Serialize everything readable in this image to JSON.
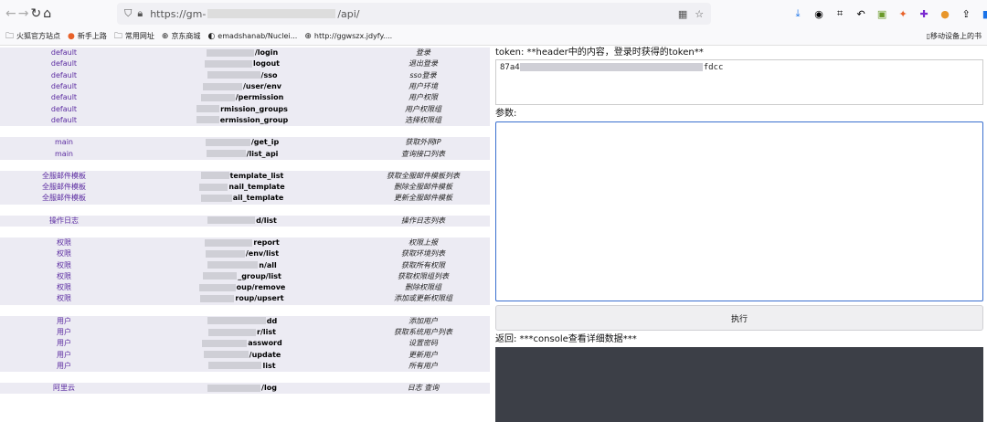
{
  "browser": {
    "url_prefix": "https://gm-",
    "url_suffix": "/api/",
    "bookmarks": [
      {
        "icon": "folder-icon",
        "label": "火狐官方站点"
      },
      {
        "icon": "firefox-icon",
        "label": "新手上路"
      },
      {
        "icon": "folder-icon",
        "label": "常用网址"
      },
      {
        "icon": "globe-icon",
        "label": "京东商城"
      },
      {
        "icon": "github-icon",
        "label": "emadshanab/Nuclei..."
      },
      {
        "icon": "globe-icon",
        "label": "http://ggwszx.jdyfy...."
      }
    ],
    "mobile_bookmarks": "移动设备上的书"
  },
  "api_groups": [
    {
      "rows": [
        {
          "module": "default",
          "path": "/login",
          "desc": "登录"
        },
        {
          "module": "default",
          "path": "logout",
          "desc": "退出登录"
        },
        {
          "module": "default",
          "path": "/sso",
          "desc": "sso登录"
        },
        {
          "module": "default",
          "path": "/user/env",
          "desc": "用户环境"
        },
        {
          "module": "default",
          "path": "/permission",
          "desc": "用户权限"
        },
        {
          "module": "default",
          "path": "rmission_groups",
          "desc": "用户权限组"
        },
        {
          "module": "default",
          "path": "ermission_group",
          "desc": "选择权限组"
        }
      ]
    },
    {
      "rows": [
        {
          "module": "main",
          "path": "/get_ip",
          "desc": "获取外网IP"
        },
        {
          "module": "main",
          "path": "/list_api",
          "desc": "查询接口列表"
        }
      ]
    },
    {
      "rows": [
        {
          "module": "全服邮件模板",
          "path": "template_list",
          "desc": "获取全服邮件模板列表"
        },
        {
          "module": "全服邮件模板",
          "path": "nail_template",
          "desc": "删除全服邮件模板"
        },
        {
          "module": "全服邮件模板",
          "path": "ail_template",
          "desc": "更新全服邮件模板"
        }
      ]
    },
    {
      "rows": [
        {
          "module": "操作日志",
          "path": "d/list",
          "desc": "操作日志列表"
        }
      ]
    },
    {
      "rows": [
        {
          "module": "权限",
          "path": "report",
          "desc": "权限上报"
        },
        {
          "module": "权限",
          "path": "/env/list",
          "desc": "获取环境列表"
        },
        {
          "module": "权限",
          "path": "n/all",
          "desc": "获取所有权限"
        },
        {
          "module": "权限",
          "path": "_group/list",
          "desc": "获取权限组列表"
        },
        {
          "module": "权限",
          "path": "oup/remove",
          "desc": "删除权限组"
        },
        {
          "module": "权限",
          "path": "roup/upsert",
          "desc": "添加或更新权限组"
        }
      ]
    },
    {
      "rows": [
        {
          "module": "用户",
          "path": "dd",
          "desc": "添加用户"
        },
        {
          "module": "用户",
          "path": "r/list",
          "desc": "获取系统用户列表"
        },
        {
          "module": "用户",
          "path": "assword",
          "desc": "设置密码"
        },
        {
          "module": "用户",
          "path": "/update",
          "desc": "更新用户"
        },
        {
          "module": "用户",
          "path": "list",
          "desc": "所有用户"
        }
      ]
    },
    {
      "rows": [
        {
          "module": "阿里云",
          "path": "/log",
          "desc": "日志 查询"
        }
      ]
    }
  ],
  "right_panel": {
    "token_label": "token: **header中的内容，登录时获得的token**",
    "token_prefix": "87a4",
    "token_suffix": "fdcc",
    "params_label": "参数:",
    "exec_label": "执行",
    "result_label": "返回: ***console查看详细数据***"
  }
}
